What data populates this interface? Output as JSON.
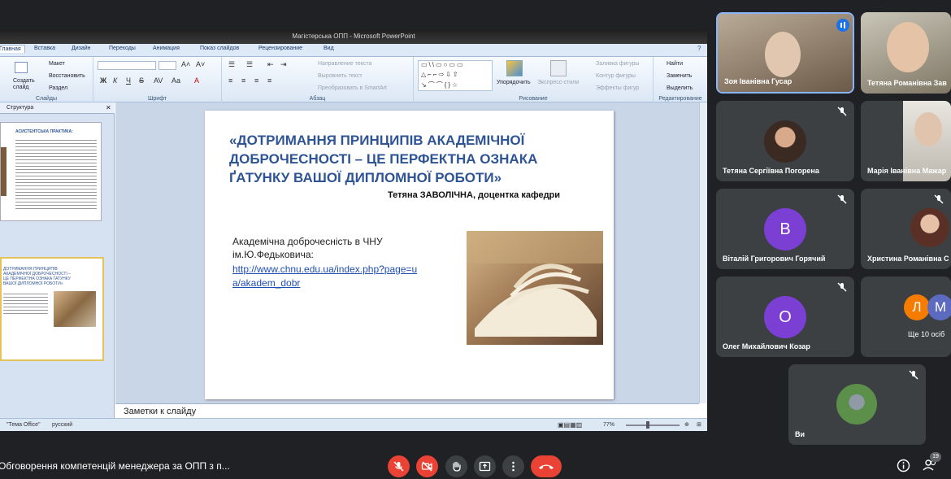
{
  "window": {
    "title": "Магістерська ОПП - Microsoft PowerPoint"
  },
  "ribbon": {
    "tabs": [
      "Главная",
      "Вставка",
      "Дизайн",
      "Переходы",
      "Анимация",
      "Показ слайдов",
      "Рецензирование",
      "Вид"
    ],
    "active_tab": "Главная",
    "groups": {
      "slides": {
        "label": "Слайды",
        "new_slide": "Создать слайд",
        "layout": "Макет",
        "reset": "Восстановить",
        "section": "Раздел"
      },
      "font": {
        "label": "Шрифт"
      },
      "paragraph": {
        "label": "Абзац",
        "text_direction": "Направление текста",
        "align_text": "Выровнять текст",
        "smartart": "Преобразовать в SmartArt"
      },
      "drawing": {
        "label": "Рисование",
        "arrange": "Упорядочить",
        "quick_styles": "Экспресс-стили",
        "fill": "Заливка фигуры",
        "outline": "Контур фигуры",
        "effects": "Эффекты фигур"
      },
      "editing": {
        "label": "Редактирование",
        "find": "Найти",
        "replace": "Заменить",
        "select": "Выделить"
      }
    }
  },
  "left_panel": {
    "tab": "Структура",
    "slide1": {
      "title": "АСИСТЕНТСЬКА ПРАКТИКА:"
    },
    "slide2": {
      "title": "ДОТРИМАННЯ ПРИНЦИПІВ АКАДЕМІЧНОЇ ДОБРОЧЕСНОСТІ – ЦЕ ПЕРФЕКТНА ОЗНАКА ҐАТУНКУ ВАШОЇ ДИПЛОМНОЇ РОБОТИ»"
    }
  },
  "slide": {
    "title": "«ДОТРИМАННЯ ПРИНЦИПІВ АКАДЕМІЧНОЇ ДОБРОЧЕСНОСТІ – ЦЕ ПЕРФЕКТНА ОЗНАКА ҐАТУНКУ ВАШОЇ ДИПЛОМНОЇ РОБОТИ»",
    "author": "Тетяна ЗАВОЛІЧНА, доцентка кафедри",
    "body_line1": "Академічна доброчесність в ЧНУ",
    "body_line2": "ім.Ю.Федьковича:",
    "link_line1": "http://www.chnu.edu.ua/index.php?page=u",
    "link_line2": "a/akadem_dobr"
  },
  "notes": {
    "placeholder": "Заметки к слайду"
  },
  "status_bar": {
    "theme": "\"Тема Office\"",
    "language": "русский",
    "zoom": "77%"
  },
  "participants": [
    {
      "name": "Зоя Іванівна Гусар",
      "speaking": true
    },
    {
      "name": "Тетяна Романівна Зав"
    },
    {
      "name": "Тетяна Сергіївна Погорена",
      "muted": true
    },
    {
      "name": "Марія Іванівна Мажар",
      "muted": true
    },
    {
      "name": "Віталій Григорович Горячий",
      "initial": "В",
      "avatar_color": "#7b3fd4",
      "muted": true
    },
    {
      "name": "Христина Романівна С",
      "muted": true
    },
    {
      "name": "Олег Михайлович Козар",
      "initial": "О",
      "avatar_color": "#7b3fd4",
      "muted": true
    },
    {
      "more": "Ще 10 осіб",
      "initials": [
        "Л",
        "М"
      ],
      "colors": [
        "#f57c00",
        "#5c6bc0"
      ]
    },
    {
      "name": "Ви",
      "muted": true
    }
  ],
  "meeting": {
    "title": "Обговорення компетенцій менеджера за ОПП з п...",
    "participant_count": "19"
  },
  "colors": {
    "meet_bg": "#202124",
    "tile_bg": "#3c4043",
    "hangup": "#ea4335",
    "slide_title": "#2f5496"
  }
}
